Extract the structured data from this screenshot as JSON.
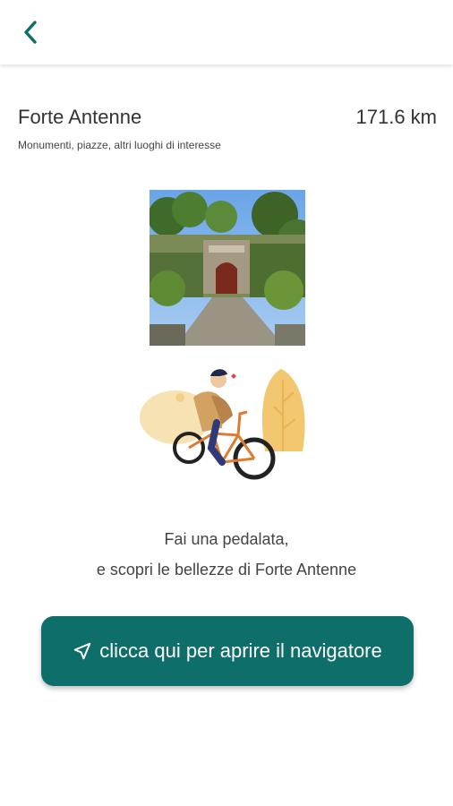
{
  "header": {
    "back_icon": "chevron-left-icon"
  },
  "place": {
    "name": "Forte Antenne",
    "distance": "171.6 km",
    "category": "Monumenti, piazze, altri luoghi di interesse"
  },
  "message": {
    "line1": "Fai una pedalata,",
    "line2": "e scopri le bellezze di Forte Antenne"
  },
  "navigator_button": {
    "label": "clicca qui per aprire il navigatore",
    "icon": "navigation-arrow-icon"
  },
  "colors": {
    "accent": "#0e6f6a",
    "text": "#333333",
    "background": "#ffffff"
  }
}
